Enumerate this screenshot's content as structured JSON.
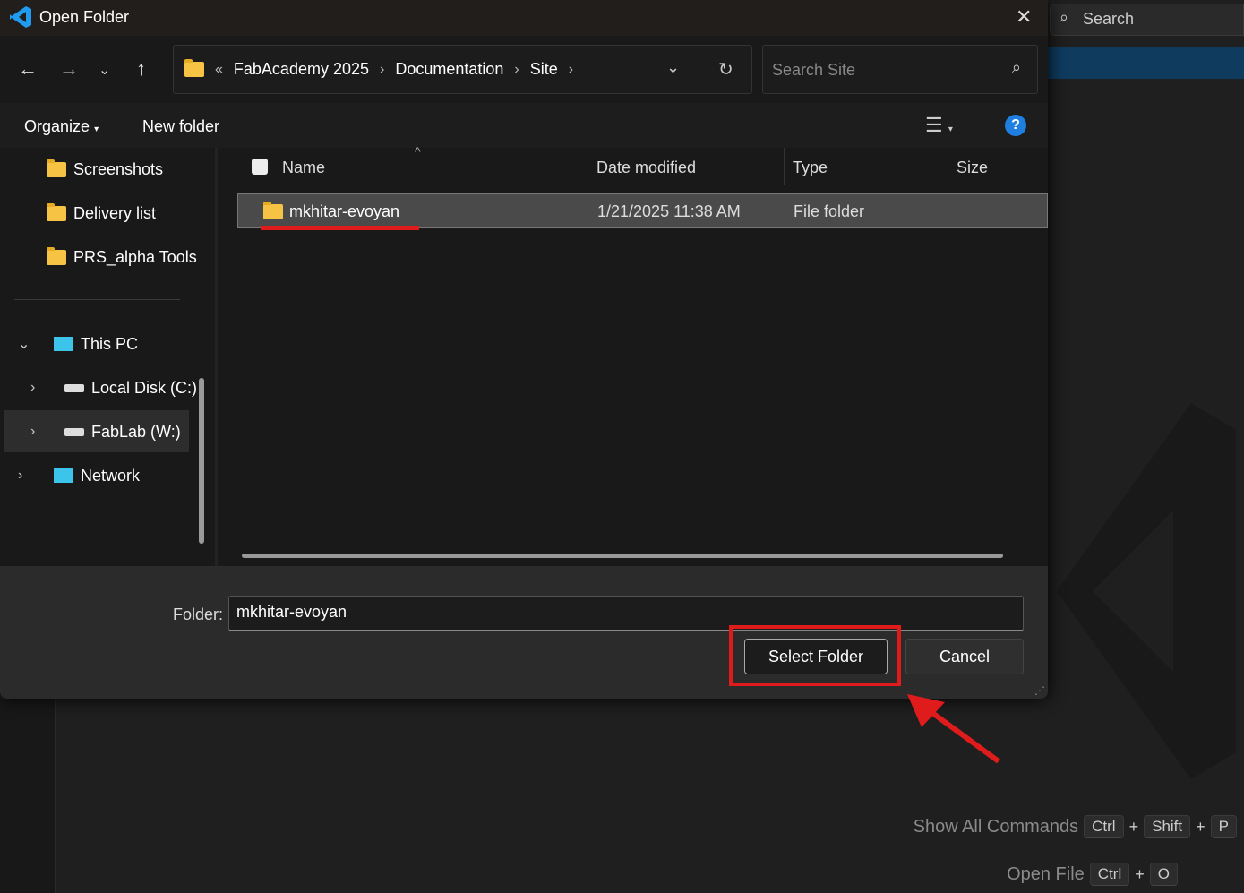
{
  "dialog": {
    "title": "Open Folder",
    "breadcrumb": [
      "FabAcademy 2025",
      "Documentation",
      "Site"
    ],
    "overflow": "«",
    "search_placeholder": "Search Site",
    "organize": "Organize",
    "new_folder": "New folder"
  },
  "sidebar": {
    "quick": [
      "Screenshots",
      "Delivery list",
      "PRS_alpha Tools"
    ],
    "this_pc": "This PC",
    "drives": [
      "Local Disk (C:)",
      "FabLab (W:)"
    ],
    "network": "Network"
  },
  "columns": {
    "name": "Name",
    "date": "Date modified",
    "type": "Type",
    "size": "Size"
  },
  "rows": [
    {
      "name": "mkhitar-evoyan",
      "date": "1/21/2025 11:38 AM",
      "type": "File folder",
      "size": ""
    }
  ],
  "footer": {
    "folder_label": "Folder:",
    "folder_value": "mkhitar-evoyan",
    "select": "Select Folder",
    "cancel": "Cancel"
  },
  "vscode": {
    "search": "Search",
    "commands": [
      {
        "label": "Show All Commands",
        "keys": [
          "Ctrl",
          "Shift",
          "P"
        ]
      },
      {
        "label": "Open File",
        "keys": [
          "Ctrl",
          "O"
        ]
      }
    ]
  },
  "colors": {
    "highlight": "#e01b1b",
    "accent": "#0078d4"
  }
}
